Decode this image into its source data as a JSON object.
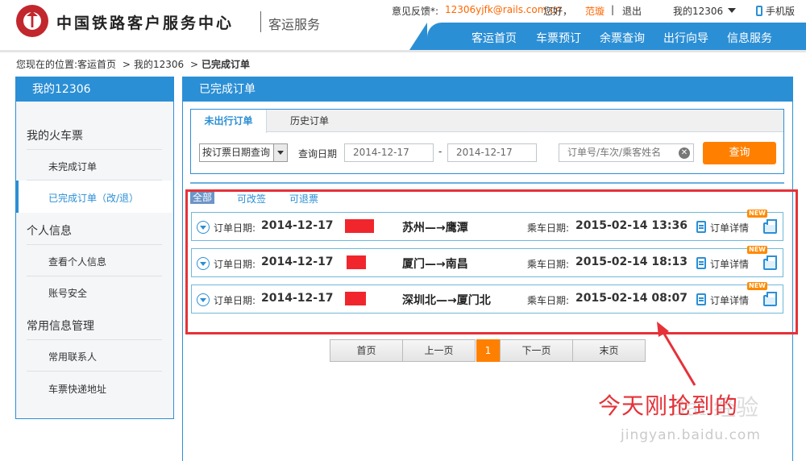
{
  "header": {
    "logo_title": "中国铁路客户服务中心",
    "logo_sub": "客运服务",
    "feedback_label": "意见反馈*:",
    "feedback_email": "12306yjfk@rails.com.cn",
    "greeting": "您好，",
    "username": "范璇",
    "bar": "|",
    "logout": "退出",
    "my12306": "我的12306",
    "mobile": "手机版",
    "nav": [
      "客运首页",
      "车票预订",
      "余票查询",
      "出行向导",
      "信息服务"
    ]
  },
  "breadcrumb": {
    "prefix": "您现在的位置:",
    "items": [
      "客运首页",
      "我的12306"
    ],
    "current": "已完成订单",
    "sep": ">"
  },
  "sidebar": {
    "title": "我的12306",
    "groups": [
      {
        "label": "我的火车票",
        "items": [
          "未完成订单",
          "已完成订单（改/退）"
        ]
      },
      {
        "label": "个人信息",
        "items": [
          "查看个人信息",
          "账号安全"
        ]
      },
      {
        "label": "常用信息管理",
        "items": [
          "常用联系人",
          "车票快递地址"
        ]
      }
    ]
  },
  "main": {
    "title": "已完成订单",
    "tabs": [
      "未出行订单",
      "历史订单"
    ],
    "active_tab": 0,
    "search": {
      "query_type": "按订票日期查询",
      "date_label": "查询日期",
      "date_from": "2014-12-17",
      "date_to": "2014-12-17",
      "dash": "-",
      "keyword_placeholder": "订单号/车次/乘客姓名",
      "query_button": "查询"
    },
    "filters": [
      "全部",
      "可改签",
      "可退票"
    ],
    "active_filter": 0,
    "order_date_label": "订单日期:",
    "ride_date_label": "乘车日期:",
    "detail_label": "订单详情",
    "new_badge": "NEW",
    "orders": [
      {
        "order_date": "2014-12-17",
        "route": "苏州—→鹰潭",
        "ride_date": "2015-02-14 13:36"
      },
      {
        "order_date": "2014-12-17",
        "route": "厦门—→南昌",
        "ride_date": "2015-02-14 18:13"
      },
      {
        "order_date": "2014-12-17",
        "route": "深圳北—→厦门北",
        "ride_date": "2015-02-14 08:07"
      }
    ],
    "pager": {
      "first": "首页",
      "prev": "上一页",
      "current": "1",
      "next": "下一页",
      "last": "末页"
    }
  },
  "annotation": "今天刚抢到的",
  "watermark": {
    "main": "Bai 经验",
    "sub": "jingyan.baidu.com"
  },
  "colors": {
    "brand_blue": "#2b8fd5",
    "accent_orange": "#ff8000",
    "annotation_red": "#e53238",
    "logo_red": "#c1272d"
  }
}
